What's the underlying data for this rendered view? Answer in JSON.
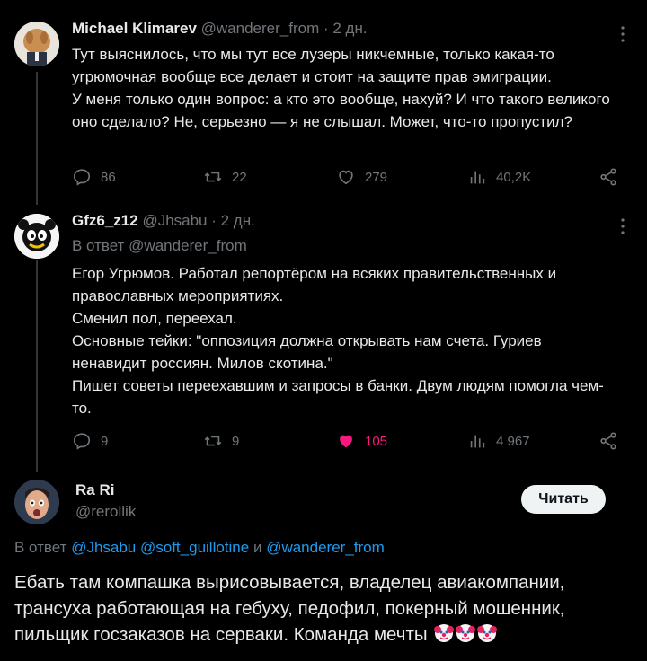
{
  "tweets": [
    {
      "name": "Michael Klimarev",
      "handle": "@wanderer_from",
      "time": "· 2 дн.",
      "text": "Тут выяснилось, что мы тут все лузеры никчемные, только какая-то угрюмочная вообще все делает и стоит на защите прав эмиграции.\nУ меня только один вопрос: а кто это вообще, нахуй? И что такого великого оно сделало? Не, серьезно — я не слышал. Может, что-то пропустил?",
      "replies": "86",
      "retweets": "22",
      "likes": "279",
      "views": "40,2K"
    },
    {
      "name": "Gfz6_z12",
      "handle": "@Jhsabu",
      "time": "· 2 дн.",
      "reply_to": "В ответ @wanderer_from",
      "text": "Егор Угрюмов. Работал репортёром на всяких правительственных и православных мероприятиях.\nСменил пол, переехал.\nОсновные тейки: \"оппозиция должна открывать нам счета. Гуриев ненавидит россиян. Милов скотина.\"\nПишет советы переехавшим и запросы в банки. Двум людям помогла чем-то.",
      "replies": "9",
      "retweets": "9",
      "likes": "105",
      "views": "4 967"
    }
  ],
  "main_tweet": {
    "name": "Ra Ri",
    "handle": "@rerollik",
    "follow_label": "Читать",
    "reply_prefix": "В ответ",
    "mention1": "@Jhsabu",
    "mention2": "@soft_guillotine",
    "conj": "и",
    "mention3": "@wanderer_from",
    "text": "Ебать там компашка вырисовывается, владелец авиакомпании, трансуха работающая на гебуху, педофил, покерный мошенник, пильщик госзаказов на серваки. Команда мечты"
  },
  "colors": {
    "accent": "#1d9bf0",
    "like": "#f91880",
    "muted": "#71767b",
    "background": "#000000"
  },
  "icons": [
    "reply-icon",
    "retweet-icon",
    "like-icon",
    "views-icon",
    "share-icon",
    "more-icon",
    "clown-emoji"
  ]
}
